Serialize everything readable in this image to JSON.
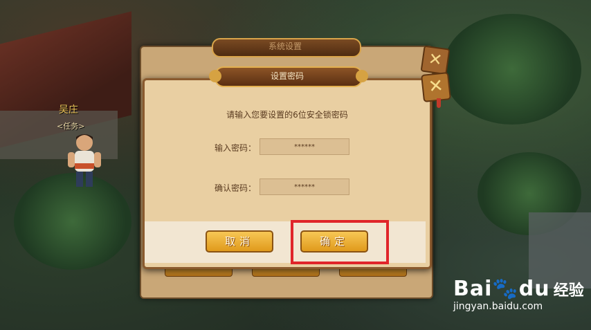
{
  "scene": {
    "npc_name": "吴庄",
    "npc_tag": "<任务>"
  },
  "back_panel": {
    "title": "系统设置"
  },
  "dialog": {
    "title": "设置密码",
    "prompt": "请输入您要设置的6位安全锁密码",
    "close_label": "✕",
    "fields": [
      {
        "label": "输入密码：",
        "value": "******"
      },
      {
        "label": "确认密码：",
        "value": "******"
      }
    ],
    "cancel_label": "取消",
    "confirm_label": "确定"
  },
  "watermark": {
    "logo": "Bai",
    "logo_tail": "du",
    "cn": "经验",
    "url": "jingyan.baidu.com"
  },
  "colors": {
    "highlight": "#e0252a",
    "button": "#f2b73c",
    "dialog_bg": "#e9cfa2"
  }
}
